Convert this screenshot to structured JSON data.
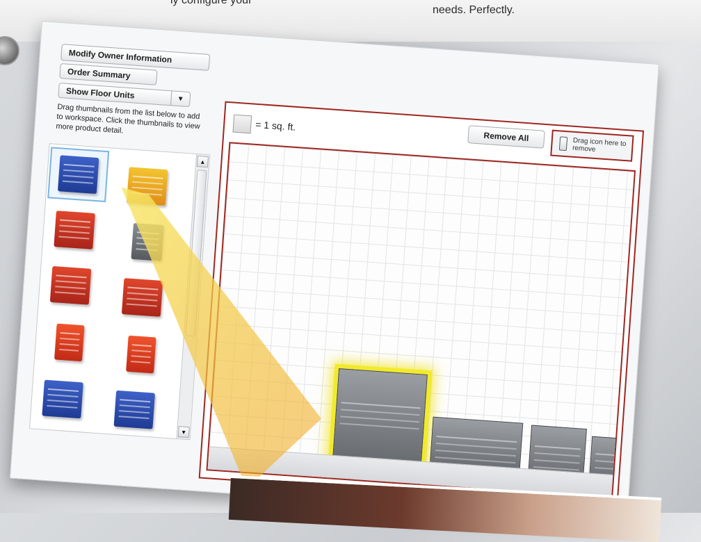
{
  "headline": {
    "left_fragment": "ly configure your",
    "right_fragment": "needs. Perfectly."
  },
  "toolbar": {
    "modify_owner_label": "Modify Owner Information",
    "order_summary_label": "Order Summary",
    "floor_units_label": "Show Floor Units",
    "dropdown_arrow": "▼"
  },
  "instructions": "Drag thumbnails from the list below to add to workspace. Click the thumbnails to view more product detail.",
  "thumbnails": [
    {
      "color": "#2f4fb5"
    },
    {
      "color": "#f0b52a"
    },
    {
      "color": "#c8372a"
    },
    {
      "color": "#6e7277"
    },
    {
      "color": "#c8372a"
    },
    {
      "color": "#c8372a"
    },
    {
      "color": "#e24422"
    },
    {
      "color": "#e24422"
    },
    {
      "color": "#2f4fb5"
    },
    {
      "color": "#2f4fb5"
    }
  ],
  "workspace": {
    "legend_text": "= 1 sq. ft.",
    "remove_all_label": "Remove All",
    "trash_label": "Drag icon here to remove"
  },
  "colors": {
    "frame_red": "#9f2620",
    "highlight_yellow": "#f1ea2d"
  }
}
